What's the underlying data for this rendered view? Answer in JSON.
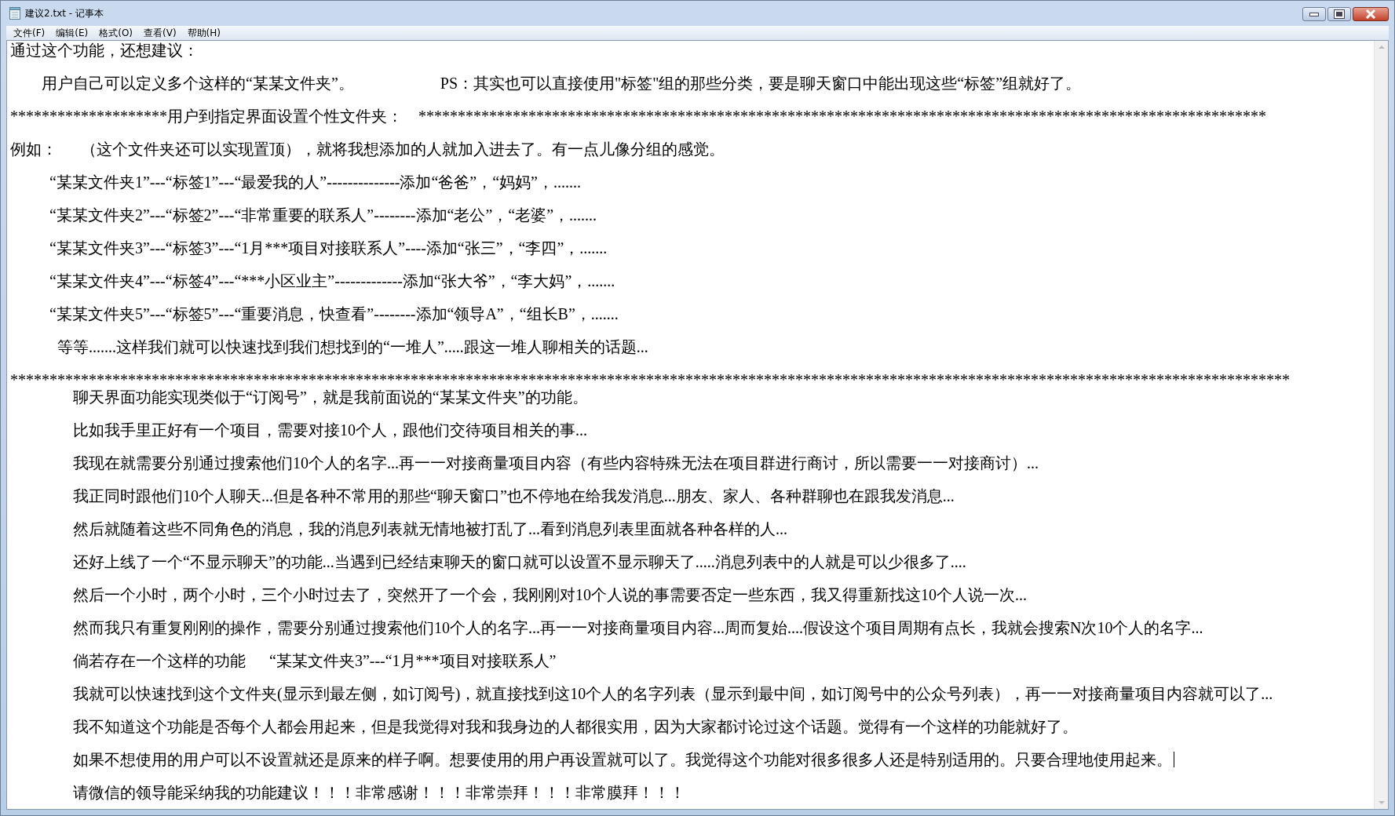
{
  "window": {
    "title": "建议2.txt - 记事本"
  },
  "menu": [
    "文件(F)",
    "编辑(E)",
    "格式(O)",
    "查看(V)",
    "帮助(H)"
  ],
  "lines": [
    {
      "kind": "text",
      "text": "通过这个功能，还想建议："
    },
    {
      "kind": "text",
      "text": "    用户自己可以定义多个这样的“某某文件夹”。           PS：其实也可以直接使用\"标签\"组的那些分类，要是聊天窗口中能出现这些“标签”组就好了。"
    },
    {
      "kind": "text",
      "text": "********************用户到指定界面设置个性文件夹：  ************************************************************************************************************"
    },
    {
      "kind": "text",
      "text": "例如：   （这个文件夹还可以实现置顶），就将我想添加的人就加入进去了。有一点儿像分组的感觉。"
    },
    {
      "kind": "text",
      "text": "     “某某文件夹1”---“标签1”---“最爱我的人”--------------添加“爸爸”，“妈妈”，......."
    },
    {
      "kind": "text",
      "text": "     “某某文件夹2”---“标签2”---“非常重要的联系人”--------添加“老公”，“老婆”，......."
    },
    {
      "kind": "text",
      "text": "     “某某文件夹3”---“标签3”---“1月***项目对接联系人”----添加“张三”，“李四”，......."
    },
    {
      "kind": "text",
      "text": "     “某某文件夹4”---“标签4”---“***小区业主”-------------添加“张大爷”，“李大妈”，......."
    },
    {
      "kind": "text",
      "text": "     “某某文件夹5”---“标签5”---“重要消息，快查看”--------添加“领导A”，“组长B”，......."
    },
    {
      "kind": "text",
      "text": "      等等.......这样我们就可以快速找到我们想找到的“一堆人”.....跟这一堆人聊相关的话题..."
    },
    {
      "kind": "separator",
      "text": "*******************************************************************************************************************************************************************"
    },
    {
      "kind": "text",
      "text": "        聊天界面功能实现类似于“订阅号”，就是我前面说的“某某文件夹”的功能。"
    },
    {
      "kind": "text",
      "text": "        比如我手里正好有一个项目，需要对接10个人，跟他们交待项目相关的事..."
    },
    {
      "kind": "text",
      "text": "        我现在就需要分别通过搜索他们10个人的名字...再一一对接商量项目内容（有些内容特殊无法在项目群进行商讨，所以需要一一对接商讨）..."
    },
    {
      "kind": "text",
      "text": "        我正同时跟他们10个人聊天...但是各种不常用的那些“聊天窗口”也不停地在给我发消息...朋友、家人、各种群聊也在跟我发消息..."
    },
    {
      "kind": "text",
      "text": "        然后就随着这些不同角色的消息，我的消息列表就无情地被打乱了...看到消息列表里面就各种各样的人..."
    },
    {
      "kind": "text",
      "text": "        还好上线了一个“不显示聊天”的功能...当遇到已经结束聊天的窗口就可以设置不显示聊天了.....消息列表中的人就是可以少很多了...."
    },
    {
      "kind": "text",
      "text": "        然后一个小时，两个小时，三个小时过去了，突然开了一个会，我刚刚对10个人说的事需要否定一些东西，我又得重新找这10个人说一次..."
    },
    {
      "kind": "text",
      "text": "        然而我只有重复刚刚的操作，需要分别通过搜索他们10个人的名字...再一一对接商量项目内容...周而复始....假设这个项目周期有点长，我就会搜索N次10个人的名字..."
    },
    {
      "kind": "text",
      "text": "        倘若存在一个这样的功能   “某某文件夹3”---“1月***项目对接联系人”"
    },
    {
      "kind": "text",
      "text": "        我就可以快速找到这个文件夹(显示到最左侧，如订阅号)，就直接找到这10个人的名字列表（显示到最中间，如订阅号中的公众号列表），再一一对接商量项目内容就可以了..."
    },
    {
      "kind": "text",
      "text": "        我不知道这个功能是否每个人都会用起来，但是我觉得对我和我身边的人都很实用，因为大家都讨论过这个话题。觉得有一个这样的功能就好了。"
    },
    {
      "kind": "text",
      "text": "        如果不想使用的用户可以不设置就还是原来的样子啊。想要使用的用户再设置就可以了。我觉得这个功能对很多很多人还是特别适用的。只要合理地使用起来。",
      "caret": true
    },
    {
      "kind": "text",
      "text": "        请微信的领导能采纳我的功能建议！！！非常感谢！！！非常崇拜！！！非常膜拜！！！"
    }
  ]
}
